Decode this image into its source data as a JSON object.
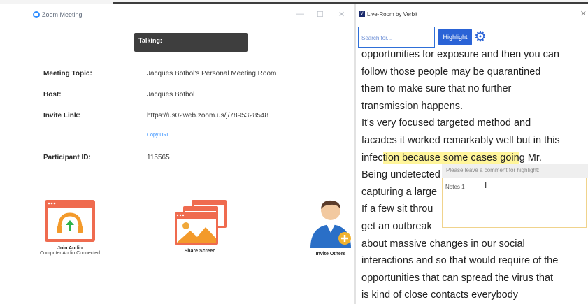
{
  "zoom": {
    "window_title": "Zoom Meeting",
    "talking_label": "Talking:",
    "info": [
      {
        "label": "Meeting Topic:",
        "value": "Jacques Botbol's Personal Meeting Room"
      },
      {
        "label": "Host:",
        "value": "Jacques Botbol"
      },
      {
        "label": "Invite Link:",
        "value": "https://us02web.zoom.us/j/7895328548"
      },
      {
        "label": "Participant ID:",
        "value": "115565"
      }
    ],
    "copy_url": "Copy URL",
    "actions": {
      "join_audio": "Join Audio",
      "join_audio_sub": "Computer Audio Connected",
      "share_screen": "Share Screen",
      "invite_others": "Invite Others"
    },
    "colors": {
      "accent": "#2d8cff",
      "orange": "#ef6b4f",
      "talking_bg": "#3e3e3e"
    }
  },
  "verbit": {
    "window_title": "Live-Room by Verbit",
    "search_placeholder": "Search for...",
    "highlight_button": "Highlight",
    "transcript_lines": [
      {
        "text": "opportunities for exposure and then you can"
      },
      {
        "text": "follow those people may be quarantined"
      },
      {
        "text": "them to make sure that no further"
      },
      {
        "text": "transmission happens."
      },
      {
        "text": "It's very focused targeted method and"
      },
      {
        "text": "facades it worked remarkably well but in this"
      },
      {
        "pre": "infec",
        "hl": "tion because some cases goin",
        "post": "g Mr."
      },
      {
        "text": "Being undetected"
      },
      {
        "text": "capturing a large"
      },
      {
        "text": "If a few sit throu"
      },
      {
        "text": "get an outbreak"
      },
      {
        "text": "about massive changes in our social"
      },
      {
        "text": "interactions and so that would require of the"
      },
      {
        "text": "opportunities that can spread the virus that"
      },
      {
        "text": "is kind of close contacts everybody"
      }
    ],
    "comment_prompt": "Please leave a comment for highlight:",
    "comment_value": "Notes 1",
    "colors": {
      "highlight": "#fff59a",
      "button": "#2a63d6"
    }
  }
}
